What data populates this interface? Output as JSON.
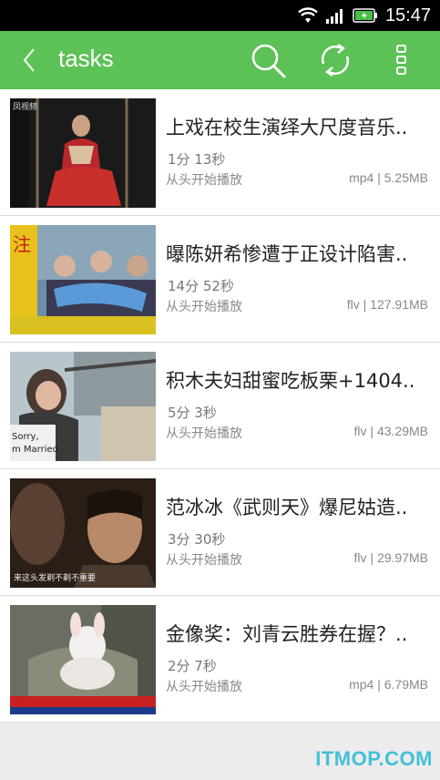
{
  "status_bar": {
    "time": "15:47"
  },
  "app_bar": {
    "title": "tasks"
  },
  "colors": {
    "accent": "#5cc156",
    "watermark": "#45c0d8"
  },
  "tasks": [
    {
      "name": "上戏在校生演绎大尺度音乐..",
      "duration": "1分 13秒",
      "replay": "从头开始播放",
      "meta": "mp4 | 5.25MB"
    },
    {
      "name": "曝陈妍希惨遭于正设计陷害..",
      "duration": "14分 52秒",
      "replay": "从头开始播放",
      "meta": "flv | 127.91MB"
    },
    {
      "name": "积木夫妇甜蜜吃板栗+1404..",
      "duration": "5分 3秒",
      "replay": "从头开始播放",
      "meta": "flv | 43.29MB"
    },
    {
      "name": "范冰冰《武则天》爆尼姑造..",
      "duration": "3分 30秒",
      "replay": "从头开始播放",
      "meta": "flv | 29.97MB"
    },
    {
      "name": "金像奖：刘青云胜券在握？..",
      "duration": "2分 7秒",
      "replay": "从头开始播放",
      "meta": "mp4 | 6.79MB"
    }
  ],
  "watermark": "ITMOP.COM"
}
